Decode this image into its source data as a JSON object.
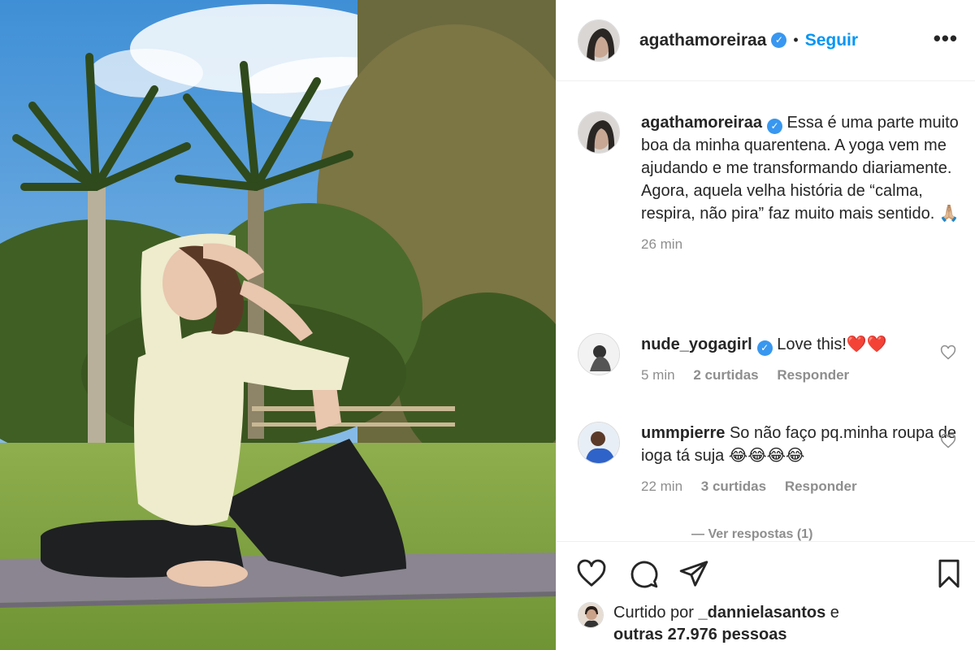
{
  "post": {
    "username": "agathamoreiraa",
    "verified_mark": "✓",
    "separator": "•",
    "follow_label": "Seguir",
    "more_icon": "•••"
  },
  "caption": {
    "username": "agathamoreiraa",
    "text": "Essa é uma parte muito boa da minha quarentena. A yoga vem me ajudando e me transformando diariamente. Agora, aquela velha história de “calma, respira, não pira” faz muito mais sentido. 🙏🏼",
    "time": "26 min"
  },
  "comments": [
    {
      "username": "nude_yogagirl",
      "verified": true,
      "text": "Love this!❤️❤️",
      "time": "5 min",
      "likes": "2 curtidas",
      "reply": "Responder"
    },
    {
      "username": "ummpierre",
      "verified": false,
      "text": "So não faço pq.minha roupa de ioga tá suja 😂😂😂😂",
      "time": "22 min",
      "likes": "3 curtidas",
      "reply": "Responder"
    }
  ],
  "view_replies": "— Ver respostas (1)",
  "liked_by": {
    "prefix": "Curtido por",
    "user": "_dannielasantos",
    "conj": "e",
    "others": "outras 27.976 pessoas"
  },
  "icons": {
    "like": "heart-icon",
    "comment": "comment-icon",
    "share": "paper-plane-icon",
    "save": "bookmark-icon"
  },
  "colors": {
    "link_blue": "#0095f6",
    "verified_blue": "#3897f0",
    "muted": "#8e8e8e"
  }
}
